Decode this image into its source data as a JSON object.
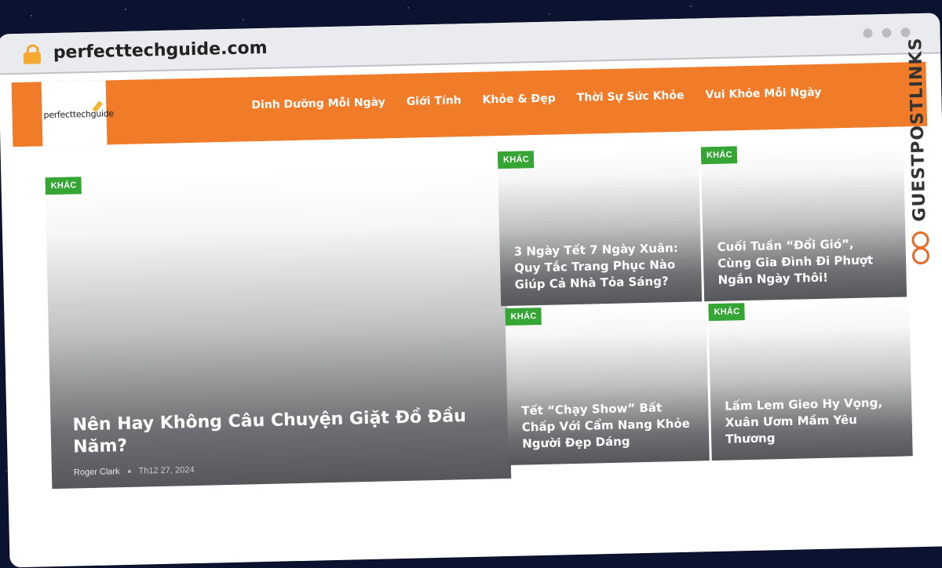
{
  "browser": {
    "url": "perfecttechguide.com"
  },
  "site": {
    "logo_text": "perfecttechguide",
    "menu": [
      {
        "label": "Dinh Dưỡng Mỗi Ngày"
      },
      {
        "label": "Giới Tính"
      },
      {
        "label": "Khỏe & Đẹp"
      },
      {
        "label": "Thời Sự Sức Khỏe"
      },
      {
        "label": "Vui Khỏe Mỗi Ngày"
      }
    ]
  },
  "posts": {
    "featured": {
      "category": "KHÁC",
      "title": "Nên Hay Không Câu Chuyện Giặt Đồ Đầu Năm?",
      "author": "Roger Clark",
      "date": "Th12 27, 2024"
    },
    "grid": [
      {
        "category": "KHÁC",
        "title": "3 Ngày Tết 7 Ngày Xuân: Quy Tắc Trang Phục Nào Giúp Cả Nhà Tỏa Sáng?"
      },
      {
        "category": "KHÁC",
        "title": "Cuối Tuần “Đổi Gió”, Cùng Gia Đình Đi Phượt Ngắn Ngày Thôi!"
      },
      {
        "category": "KHÁC",
        "title": "Tết “Chạy Show” Bất Chấp Với Cẩm Nang Khỏe Người Đẹp Dáng"
      },
      {
        "category": "KHÁC",
        "title": "Lấm Lem Gieo Hy Vọng, Xuân Ươm Mầm Yêu Thương"
      }
    ]
  },
  "watermark": {
    "text": "GUESTPOSTLINKS",
    "icon": "link-icon",
    "color": "#e8682a"
  },
  "colors": {
    "nav": "#f07c2a",
    "badge": "#35a533",
    "lock": "#f4a930"
  }
}
